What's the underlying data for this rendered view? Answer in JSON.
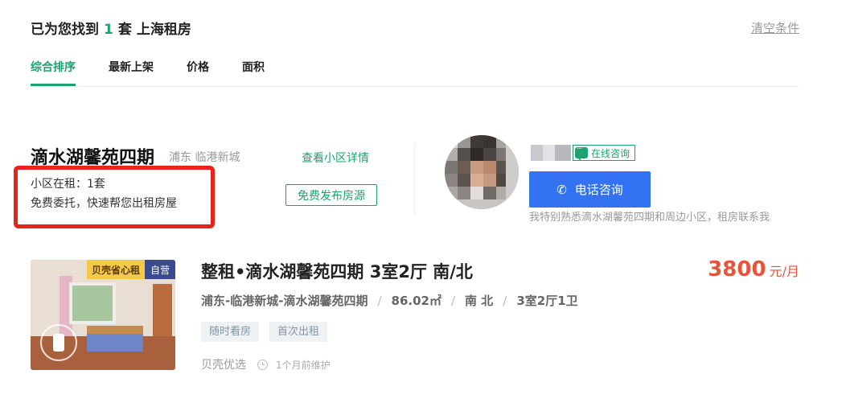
{
  "summary": {
    "prefix": "已为您找到",
    "count": "1",
    "unit": "套",
    "city": "上海租房",
    "clear": "清空条件"
  },
  "sort_tabs": [
    {
      "label": "综合排序",
      "active": true
    },
    {
      "label": "最新上架",
      "active": false
    },
    {
      "label": "价格",
      "active": false
    },
    {
      "label": "面积",
      "active": false
    }
  ],
  "community": {
    "name": "滴水湖馨苑四期",
    "location": "浦东 临港新城",
    "detail_link": "查看小区详情",
    "rent_count": "小区在租：1套",
    "entrust": "免费委托，快速帮您出租房屋",
    "publish_button": "免费发布房源"
  },
  "agent": {
    "online_chat": "在线咨询",
    "phone_button": "电话咨询",
    "description": "我特别熟悉滴水湖馨苑四期和周边小区，租房联系我"
  },
  "listing": {
    "tag_beike": "贝壳省心租",
    "tag_self": "自营",
    "title": "整租•滴水湖馨苑四期 3室2厅 南/北",
    "price": "3800",
    "price_unit": "元/月",
    "desc": {
      "area_path": "浦东-临港新城-滴水湖馨苑四期",
      "size": "86.02㎡",
      "orientation": "南 北",
      "layout": "3室2厅1卫"
    },
    "tags": [
      "随时看房",
      "首次出租"
    ],
    "brand": "贝壳优选",
    "updated": "1个月前维护"
  },
  "colors": {
    "accent_green": "#1aa36f",
    "phone_blue": "#3372f0",
    "price_red": "#e6543a",
    "highlight_red": "#e8231c"
  },
  "icons": {
    "phone": "phone-icon",
    "chat": "chat-icon",
    "clock": "clock-icon"
  }
}
